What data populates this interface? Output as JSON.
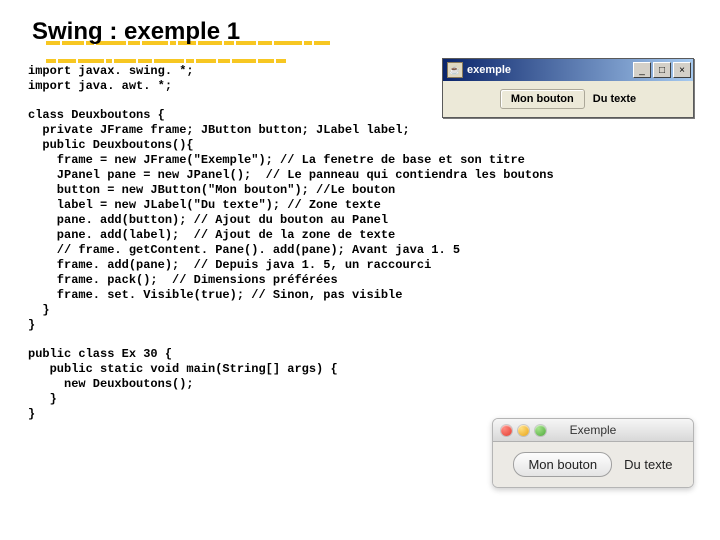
{
  "slide": {
    "title": "Swing : exemple 1"
  },
  "code_block_1": "import javax. swing. *;\nimport java. awt. *;",
  "code_block_2": "class Deuxboutons {\n  private JFrame frame; JButton button; JLabel label;\n  public Deuxboutons(){\n    frame = new JFrame(\"Exemple\"); // La fenetre de base et son titre\n    JPanel pane = new JPanel();  // Le panneau qui contiendra les boutons\n    button = new JButton(\"Mon bouton\"); //Le bouton\n    label = new JLabel(\"Du texte\"); // Zone texte\n    pane. add(button); // Ajout du bouton au Panel\n    pane. add(label);  // Ajout de la zone de texte\n    // frame. getContent. Pane(). add(pane); Avant java 1. 5\n    frame. add(pane);  // Depuis java 1. 5, un raccourci\n    frame. pack();  // Dimensions préférées\n    frame. set. Visible(true); // Sinon, pas visible\n  }\n}",
  "code_block_3": "public class Ex 30 {\n   public static void main(String[] args) {\n     new Deuxboutons();\n   }\n}",
  "win_window": {
    "title": "exemple",
    "button_label": "Mon bouton",
    "text_label": "Du texte",
    "minimize": "_",
    "maximize": "□",
    "close": "×"
  },
  "mac_window": {
    "title": "Exemple",
    "button_label": "Mon bouton",
    "text_label": "Du texte"
  }
}
